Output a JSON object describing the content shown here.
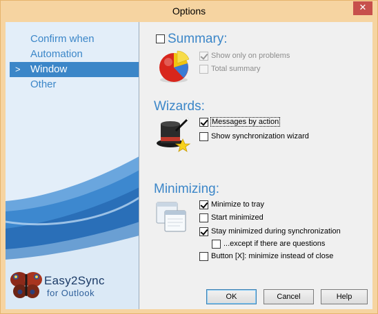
{
  "window": {
    "title": "Options",
    "close_glyph": "✕"
  },
  "sidebar": {
    "items": [
      {
        "label": "Confirm when",
        "selected": false
      },
      {
        "label": "Automation",
        "selected": false
      },
      {
        "label": "Window",
        "selected": true
      },
      {
        "label": "Other",
        "selected": false
      }
    ],
    "selected_marker": ">",
    "brand": {
      "name": "Easy2Sync",
      "sub": "for Outlook"
    },
    "accent": "#3b86c8"
  },
  "summary": {
    "title": "Summary:",
    "title_enabled": false,
    "icon": "pie-chart-icon",
    "options": [
      {
        "label": "Show only on problems",
        "checked": true,
        "enabled": false
      },
      {
        "label": "Total summary",
        "checked": false,
        "enabled": false
      }
    ]
  },
  "wizards": {
    "title": "Wizards:",
    "icon": "magic-hat-icon",
    "options": [
      {
        "label": "Messages by action",
        "checked": true,
        "enabled": true
      },
      {
        "label": "Show synchronization wizard",
        "checked": false,
        "enabled": true
      }
    ]
  },
  "minimizing": {
    "title": "Minimizing:",
    "icon": "windows-stack-icon",
    "options": [
      {
        "label": "Minimize to tray",
        "checked": true
      },
      {
        "label": "Start minimized",
        "checked": false
      },
      {
        "label": "Stay minimized during synchronization",
        "checked": true
      },
      {
        "label": "...except if there are questions",
        "checked": false
      },
      {
        "label": "Button [X]: minimize instead of close",
        "checked": false
      }
    ]
  },
  "buttons": {
    "ok": "OK",
    "cancel": "Cancel",
    "help": "Help"
  }
}
